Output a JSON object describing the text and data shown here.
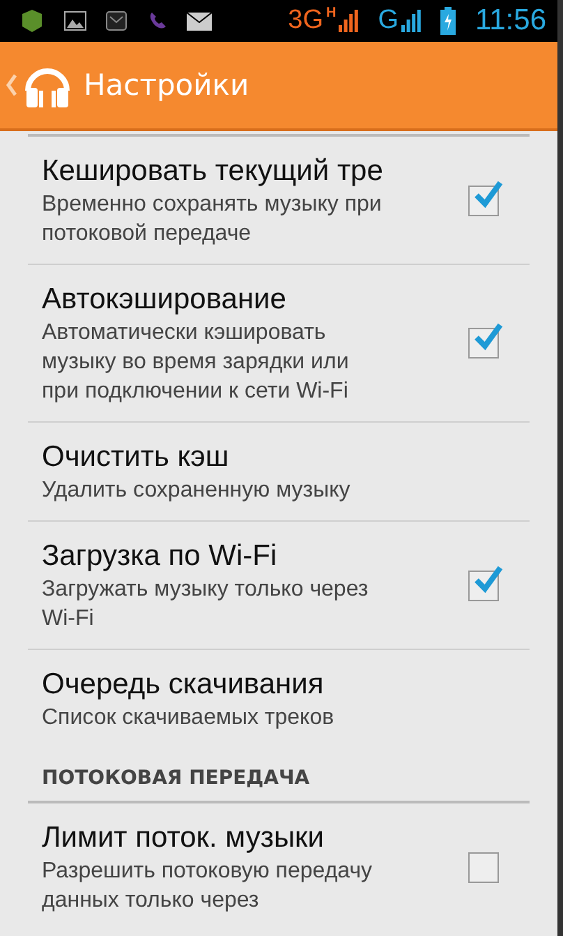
{
  "status_bar": {
    "network_1": "3G",
    "network_1_type": "H",
    "network_2": "G",
    "time": "11:56"
  },
  "action_bar": {
    "title": "Настройки"
  },
  "sections": [
    {
      "items": [
        {
          "kind": "checkbox",
          "title": "Кешировать текущий тре",
          "summary": "Временно сохранять музыку при потоковой передаче",
          "checked": true
        },
        {
          "kind": "checkbox",
          "title": "Автокэширование",
          "summary": "Автоматически кэшировать музыку во время зарядки или при подключении к сети Wi-Fi",
          "checked": true
        },
        {
          "kind": "action",
          "title": "Очистить кэш",
          "summary": "Удалить сохраненную музыку"
        },
        {
          "kind": "checkbox",
          "title": "Загрузка по Wi-Fi",
          "summary": "Загружать музыку только через Wi-Fi",
          "checked": true
        },
        {
          "kind": "action",
          "title": "Очередь скачивания",
          "summary": "Список скачиваемых треков"
        }
      ]
    },
    {
      "header": "ПОТОКОВАЯ ПЕРЕДАЧА",
      "items": [
        {
          "kind": "checkbox",
          "title": "Лимит поток. музыки",
          "summary": "Разрешить потоковую передачу данных только через",
          "checked": false
        }
      ]
    }
  ]
}
